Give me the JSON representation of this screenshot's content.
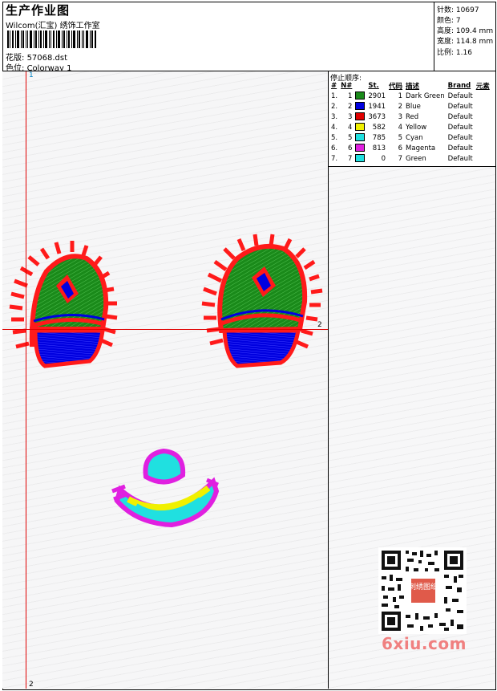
{
  "header": {
    "title": "生产作业图",
    "subtitle": "Wilcom(汇宝) 绣饰工作室",
    "file_label": "花版:",
    "file_value": "57068.dst",
    "color_label": "色位:",
    "color_value": "Colorway 1"
  },
  "stats": [
    {
      "label": "针数:",
      "value": "10697"
    },
    {
      "label": "颜色:",
      "value": "7"
    },
    {
      "label": "高度:",
      "value": "109.4 mm"
    },
    {
      "label": "宽度:",
      "value": "114.8 mm"
    },
    {
      "label": "比例:",
      "value": "1.16"
    }
  ],
  "stop_sequence": {
    "title": "停止顺序:",
    "headers": [
      "#",
      "N#",
      "St.",
      "代码",
      "描述",
      "Brand",
      "元素"
    ],
    "rows": [
      {
        "idx": "1.",
        "n": "1",
        "color": "#1a8a1a",
        "st": "2901",
        "code": "1",
        "desc": "Dark Green",
        "brand": "Default"
      },
      {
        "idx": "2.",
        "n": "2",
        "color": "#0000e0",
        "st": "1941",
        "code": "2",
        "desc": "Blue",
        "brand": "Default"
      },
      {
        "idx": "3.",
        "n": "3",
        "color": "#e00000",
        "st": "3673",
        "code": "3",
        "desc": "Red",
        "brand": "Default"
      },
      {
        "idx": "4.",
        "n": "4",
        "color": "#f0f000",
        "st": "582",
        "code": "4",
        "desc": "Yellow",
        "brand": "Default"
      },
      {
        "idx": "5.",
        "n": "5",
        "color": "#20e0e0",
        "st": "785",
        "code": "5",
        "desc": "Cyan",
        "brand": "Default"
      },
      {
        "idx": "6.",
        "n": "6",
        "color": "#e020e0",
        "st": "813",
        "code": "6",
        "desc": "Magenta",
        "brand": "Default"
      },
      {
        "idx": "7.",
        "n": "7",
        "color": "#20e0e0",
        "st": "0",
        "code": "7",
        "desc": "Green",
        "brand": "Default"
      }
    ]
  },
  "axes": {
    "v_top": "1",
    "v_bottom": "2",
    "h_right": "2"
  },
  "watermark": "6xiu.com",
  "qr_badge": "刺绣图纸",
  "colors": {
    "green": "#1a8a1a",
    "blue": "#0000e0",
    "red": "#ff1a1a",
    "yellow": "#f0f000",
    "cyan": "#20e0e0",
    "magenta": "#e020e0"
  }
}
